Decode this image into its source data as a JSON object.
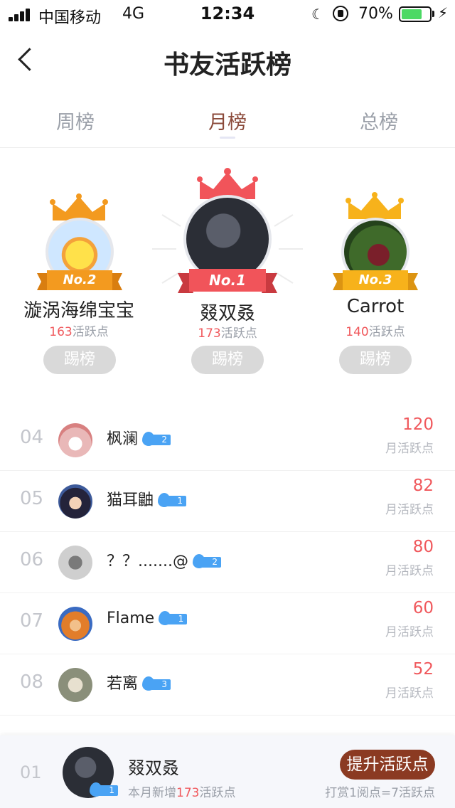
{
  "status_bar": {
    "carrier": "中国移动",
    "network": "4G",
    "time": "12:34",
    "battery": "70%"
  },
  "nav": {
    "title": "书友活跃榜",
    "back_icon": "chevron-left-icon"
  },
  "tabs": [
    {
      "label": "周榜",
      "active": false
    },
    {
      "label": "月榜",
      "active": true
    },
    {
      "label": "总榜",
      "active": false
    }
  ],
  "podium": {
    "first": {
      "badge": "No.1",
      "name": "叕双叒",
      "points": "173",
      "points_suffix": "活跃点",
      "kick_label": "踢榜",
      "ribbon_color": "#f1545a"
    },
    "second": {
      "badge": "No.2",
      "name": "漩涡海绵宝宝",
      "points": "163",
      "points_suffix": "活跃点",
      "kick_label": "踢榜",
      "ribbon_color": "#f39a1f"
    },
    "third": {
      "badge": "No.3",
      "name": "Carrot",
      "points": "140",
      "points_suffix": "活跃点",
      "kick_label": "踢榜",
      "ribbon_color": "#f7b21b"
    }
  },
  "list": [
    {
      "rank": "04",
      "name": "枫澜",
      "level": "2",
      "points": "120",
      "label": "月活跃点"
    },
    {
      "rank": "05",
      "name": "猫耳鼬",
      "level": "1",
      "points": "82",
      "label": "月活跃点"
    },
    {
      "rank": "06",
      "name": "？？.......@",
      "level": "2",
      "points": "80",
      "label": "月活跃点"
    },
    {
      "rank": "07",
      "name": "Flame",
      "level": "1",
      "points": "60",
      "label": "月活跃点"
    },
    {
      "rank": "08",
      "name": "若离",
      "level": "3",
      "points": "52",
      "label": "月活跃点"
    }
  ],
  "me": {
    "rank": "01",
    "name": "叕双叒",
    "level": "1",
    "sub_prefix": "本月新增",
    "sub_points": "173",
    "sub_suffix": "活跃点",
    "boost_label": "提升活跃点",
    "note": "打赏1阅点=7活跃点"
  },
  "colors": {
    "accent_red": "#f0585c",
    "tab_active": "#8b4a3a",
    "boost_bg": "#8b3a22",
    "level_badge": "#4aa3f4"
  }
}
